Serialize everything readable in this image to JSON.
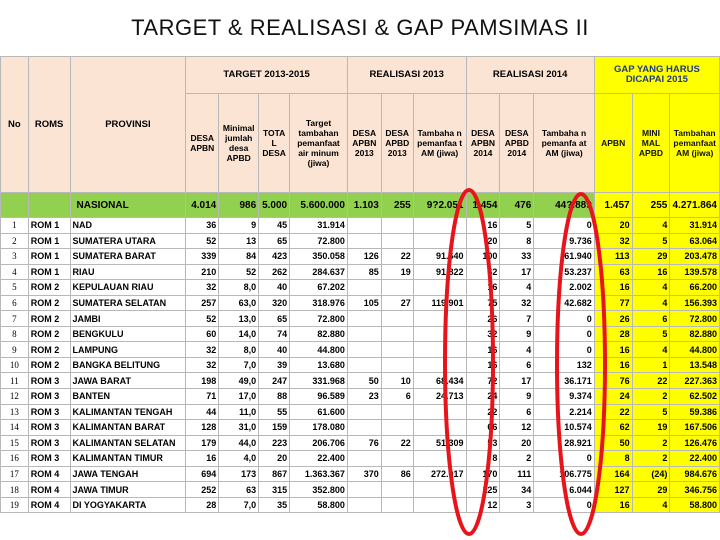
{
  "title": "TARGET & REALISASI & GAP PAMSIMAS II",
  "groups": {
    "target": "TARGET 2013-2015",
    "real2013": "REALISASI 2013",
    "real2014": "REALISASI 2014",
    "gap": "GAP YANG HARUS DICAPAI 2015"
  },
  "headers": {
    "no": "No",
    "roms": "ROMS",
    "provinsi": "PROVINSI",
    "desa_apbn": "DESA APBN",
    "min_desa_apbd": "Minimal jumlah desa APBD",
    "total_desa": "TOTA L DESA",
    "target_pemanfaat": "Target tambahan pemanfaat air minum (jiwa)",
    "r13_desa_apbn": "DESA APBN 2013",
    "r13_desa_apbd": "DESA APBD 2013",
    "r13_tambahan": "Tambaha n pemanfaa t AM (jiwa)",
    "r14_desa_apbn": "DESA APBN 2014",
    "r14_desa_apbd": "DESA APBD 2014",
    "r14_tambahan": "Tambaha n pemanfa at AM (jiwa)",
    "gap_apbn": "APBN",
    "gap_mini_apbd": "MINI MAL APBD",
    "gap_tambahan": "Tambahan pemanfaat AM (jiwa)"
  },
  "nasional": {
    "label": "NASIONAL",
    "desa_apbn": "4.014",
    "min_apbd": "986",
    "total": "5.000",
    "target_jiwa": "5.600.000",
    "r13_apbn": "1.103",
    "r13_apbd": "255",
    "r13_jiwa": "9?2.051",
    "r14_apbn": "1.454",
    "r14_apbd": "476",
    "r14_jiwa": "44?.889",
    "gap_apbn": "1.457",
    "gap_apbd": "255",
    "gap_jiwa": "4.271.864"
  },
  "rows": [
    {
      "no": "1",
      "rom": "ROM 1",
      "prov": "NAD",
      "desa_apbn": "36",
      "min_apbd": "9",
      "total": "45",
      "target": "31.914",
      "r13_apbn": "",
      "r13_apbd": "",
      "r13_jiwa": "",
      "r14_apbn": "16",
      "r14_apbd": "5",
      "r14_jiwa": "0",
      "gap_apbn": "20",
      "gap_apbd": "4",
      "gap_jiwa": "31.914"
    },
    {
      "no": "2",
      "rom": "ROM 1",
      "prov": "SUMATERA UTARA",
      "desa_apbn": "52",
      "min_apbd": "13",
      "total": "65",
      "target": "72.800",
      "r13_apbn": "",
      "r13_apbd": "",
      "r13_jiwa": "",
      "r14_apbn": "20",
      "r14_apbd": "8",
      "r14_jiwa": "9.736",
      "gap_apbn": "32",
      "gap_apbd": "5",
      "gap_jiwa": "63.064"
    },
    {
      "no": "3",
      "rom": "ROM 1",
      "prov": "SUMATERA BARAT",
      "desa_apbn": "339",
      "min_apbd": "84",
      "total": "423",
      "target": "350.058",
      "r13_apbn": "126",
      "r13_apbd": "22",
      "r13_jiwa": "91.640",
      "r14_apbn": "100",
      "r14_apbd": "33",
      "r14_jiwa": "61.940",
      "gap_apbn": "113",
      "gap_apbd": "29",
      "gap_jiwa": "203.478"
    },
    {
      "no": "4",
      "rom": "ROM 1",
      "prov": "RIAU",
      "desa_apbn": "210",
      "min_apbd": "52",
      "total": "262",
      "target": "284.637",
      "r13_apbn": "85",
      "r13_apbd": "19",
      "r13_jiwa": "91.822",
      "r14_apbn": "62",
      "r14_apbd": "17",
      "r14_jiwa": "53.237",
      "gap_apbn": "63",
      "gap_apbd": "16",
      "gap_jiwa": "139.578"
    },
    {
      "no": "5",
      "rom": "ROM 2",
      "prov": "KEPULAUAN RIAU",
      "desa_apbn": "32",
      "min_apbd": "8,0",
      "total": "40",
      "target": "67.202",
      "r13_apbn": "",
      "r13_apbd": "",
      "r13_jiwa": "",
      "r14_apbn": "16",
      "r14_apbd": "4",
      "r14_jiwa": "2.002",
      "gap_apbn": "16",
      "gap_apbd": "4",
      "gap_jiwa": "66.200"
    },
    {
      "no": "6",
      "rom": "ROM 2",
      "prov": "SUMATERA SELATAN",
      "desa_apbn": "257",
      "min_apbd": "63,0",
      "total": "320",
      "target": "318.976",
      "r13_apbn": "105",
      "r13_apbd": "27",
      "r13_jiwa": "119.901",
      "r14_apbn": "75",
      "r14_apbd": "32",
      "r14_jiwa": "42.682",
      "gap_apbn": "77",
      "gap_apbd": "4",
      "gap_jiwa": "156.393"
    },
    {
      "no": "7",
      "rom": "ROM 2",
      "prov": "JAMBI",
      "desa_apbn": "52",
      "min_apbd": "13,0",
      "total": "65",
      "target": "72.800",
      "r13_apbn": "",
      "r13_apbd": "",
      "r13_jiwa": "",
      "r14_apbn": "26",
      "r14_apbd": "7",
      "r14_jiwa": "0",
      "gap_apbn": "26",
      "gap_apbd": "6",
      "gap_jiwa": "72.800"
    },
    {
      "no": "8",
      "rom": "ROM 2",
      "prov": "BENGKULU",
      "desa_apbn": "60",
      "min_apbd": "14,0",
      "total": "74",
      "target": "82.880",
      "r13_apbn": "",
      "r13_apbd": "",
      "r13_jiwa": "",
      "r14_apbn": "32",
      "r14_apbd": "9",
      "r14_jiwa": "0",
      "gap_apbn": "28",
      "gap_apbd": "5",
      "gap_jiwa": "82.880"
    },
    {
      "no": "9",
      "rom": "ROM 2",
      "prov": "LAMPUNG",
      "desa_apbn": "32",
      "min_apbd": "8,0",
      "total": "40",
      "target": "44.800",
      "r13_apbn": "",
      "r13_apbd": "",
      "r13_jiwa": "",
      "r14_apbn": "16",
      "r14_apbd": "4",
      "r14_jiwa": "0",
      "gap_apbn": "16",
      "gap_apbd": "4",
      "gap_jiwa": "44.800"
    },
    {
      "no": "10",
      "rom": "ROM 2",
      "prov": "BANGKA BELITUNG",
      "desa_apbn": "32",
      "min_apbd": "7,0",
      "total": "39",
      "target": "13.680",
      "r13_apbn": "",
      "r13_apbd": "",
      "r13_jiwa": "",
      "r14_apbn": "16",
      "r14_apbd": "6",
      "r14_jiwa": "132",
      "gap_apbn": "16",
      "gap_apbd": "1",
      "gap_jiwa": "13.548"
    },
    {
      "no": "11",
      "rom": "ROM 3",
      "prov": "JAWA BARAT",
      "desa_apbn": "198",
      "min_apbd": "49,0",
      "total": "247",
      "target": "331.968",
      "r13_apbn": "50",
      "r13_apbd": "10",
      "r13_jiwa": "68.434",
      "r14_apbn": "72",
      "r14_apbd": "17",
      "r14_jiwa": "36.171",
      "gap_apbn": "76",
      "gap_apbd": "22",
      "gap_jiwa": "227.363"
    },
    {
      "no": "12",
      "rom": "ROM 3",
      "prov": "BANTEN",
      "desa_apbn": "71",
      "min_apbd": "17,0",
      "total": "88",
      "target": "96.589",
      "r13_apbn": "23",
      "r13_apbd": "6",
      "r13_jiwa": "24.713",
      "r14_apbn": "24",
      "r14_apbd": "9",
      "r14_jiwa": "9.374",
      "gap_apbn": "24",
      "gap_apbd": "2",
      "gap_jiwa": "62.502"
    },
    {
      "no": "13",
      "rom": "ROM 3",
      "prov": "KALIMANTAN TENGAH",
      "desa_apbn": "44",
      "min_apbd": "11,0",
      "total": "55",
      "target": "61.600",
      "r13_apbn": "",
      "r13_apbd": "",
      "r13_jiwa": "",
      "r14_apbn": "22",
      "r14_apbd": "6",
      "r14_jiwa": "2.214",
      "gap_apbn": "22",
      "gap_apbd": "5",
      "gap_jiwa": "59.386"
    },
    {
      "no": "14",
      "rom": "ROM 3",
      "prov": "KALIMANTAN BARAT",
      "desa_apbn": "128",
      "min_apbd": "31,0",
      "total": "159",
      "target": "178.080",
      "r13_apbn": "",
      "r13_apbd": "",
      "r13_jiwa": "",
      "r14_apbn": "66",
      "r14_apbd": "12",
      "r14_jiwa": "10.574",
      "gap_apbn": "62",
      "gap_apbd": "19",
      "gap_jiwa": "167.506"
    },
    {
      "no": "15",
      "rom": "ROM 3",
      "prov": "KALIMANTAN SELATAN",
      "desa_apbn": "179",
      "min_apbd": "44,0",
      "total": "223",
      "target": "206.706",
      "r13_apbn": "76",
      "r13_apbd": "22",
      "r13_jiwa": "51.309",
      "r14_apbn": "53",
      "r14_apbd": "20",
      "r14_jiwa": "28.921",
      "gap_apbn": "50",
      "gap_apbd": "2",
      "gap_jiwa": "126.476"
    },
    {
      "no": "16",
      "rom": "ROM 3",
      "prov": "KALIMANTAN TIMUR",
      "desa_apbn": "16",
      "min_apbd": "4,0",
      "total": "20",
      "target": "22.400",
      "r13_apbn": "",
      "r13_apbd": "",
      "r13_jiwa": "",
      "r14_apbn": "8",
      "r14_apbd": "2",
      "r14_jiwa": "0",
      "gap_apbn": "8",
      "gap_apbd": "2",
      "gap_jiwa": "22.400"
    },
    {
      "no": "17",
      "rom": "ROM 4",
      "prov": "JAWA TENGAH",
      "desa_apbn": "694",
      "min_apbd": "173",
      "total": "867",
      "target": "1.363.367",
      "r13_apbn": "370",
      "r13_apbd": "86",
      "r13_jiwa": "272.017",
      "r14_apbn": "170",
      "r14_apbd": "111",
      "r14_jiwa": "106.775",
      "gap_apbn": "164",
      "gap_apbd": "(24)",
      "gap_jiwa": "984.676"
    },
    {
      "no": "18",
      "rom": "ROM 4",
      "prov": "JAWA TIMUR",
      "desa_apbn": "252",
      "min_apbd": "63",
      "total": "315",
      "target": "352.800",
      "r13_apbn": "",
      "r13_apbd": "",
      "r13_jiwa": "",
      "r14_apbn": "125",
      "r14_apbd": "34",
      "r14_jiwa": "6.044",
      "gap_apbn": "127",
      "gap_apbd": "29",
      "gap_jiwa": "346.756"
    },
    {
      "no": "19",
      "rom": "ROM 4",
      "prov": "DI YOGYAKARTA",
      "desa_apbn": "28",
      "min_apbd": "7,0",
      "total": "35",
      "target": "58.800",
      "r13_apbn": "",
      "r13_apbd": "",
      "r13_jiwa": "",
      "r14_apbn": "12",
      "r14_apbd": "3",
      "r14_jiwa": "0",
      "gap_apbn": "16",
      "gap_apbd": "4",
      "gap_jiwa": "58.800"
    }
  ],
  "colors": {
    "header_bg": "#fbe4d4",
    "nasional_bg": "#92d050",
    "gap_bg": "#ffff00",
    "highlight_ellipse": "#e8141b",
    "slide_bg": "#1b2a55"
  }
}
